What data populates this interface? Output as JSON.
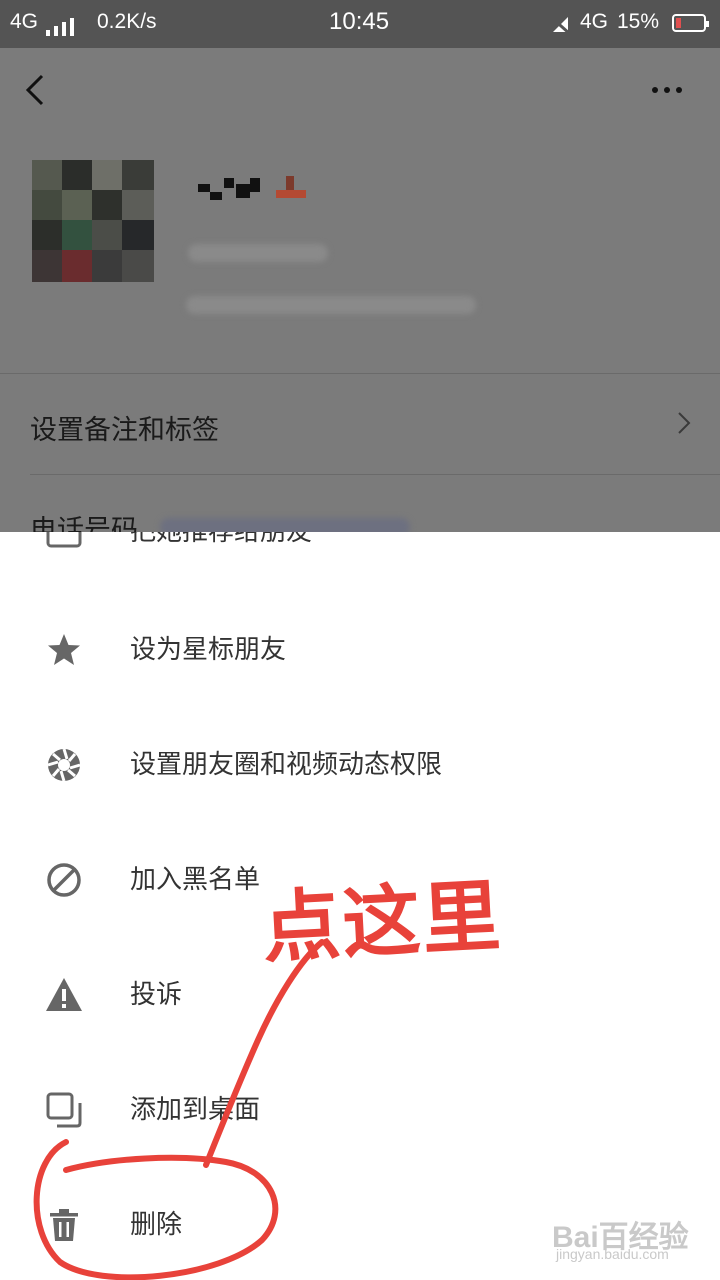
{
  "status_bar": {
    "network_left": "4G",
    "speed": "0.2K/s",
    "time": "10:45",
    "network_right": "4G",
    "battery": "15%"
  },
  "background_page": {
    "row_remark": "设置备注和标签",
    "row_phone": "电话号码"
  },
  "sheet": {
    "partial_item": "把她推荐给朋友",
    "items": [
      {
        "label": "设为星标朋友",
        "icon": "star-icon"
      },
      {
        "label": "设置朋友圈和视频动态权限",
        "icon": "moments-icon"
      },
      {
        "label": "加入黑名单",
        "icon": "block-icon"
      },
      {
        "label": "投诉",
        "icon": "warning-icon"
      },
      {
        "label": "添加到桌面",
        "icon": "add-desktop-icon"
      },
      {
        "label": "删除",
        "icon": "trash-icon"
      }
    ]
  },
  "annotation": {
    "text": "点这里",
    "color": "#e8423a"
  },
  "watermark": {
    "text": "Bai百经验",
    "url": "jingyan.baidu.com"
  }
}
